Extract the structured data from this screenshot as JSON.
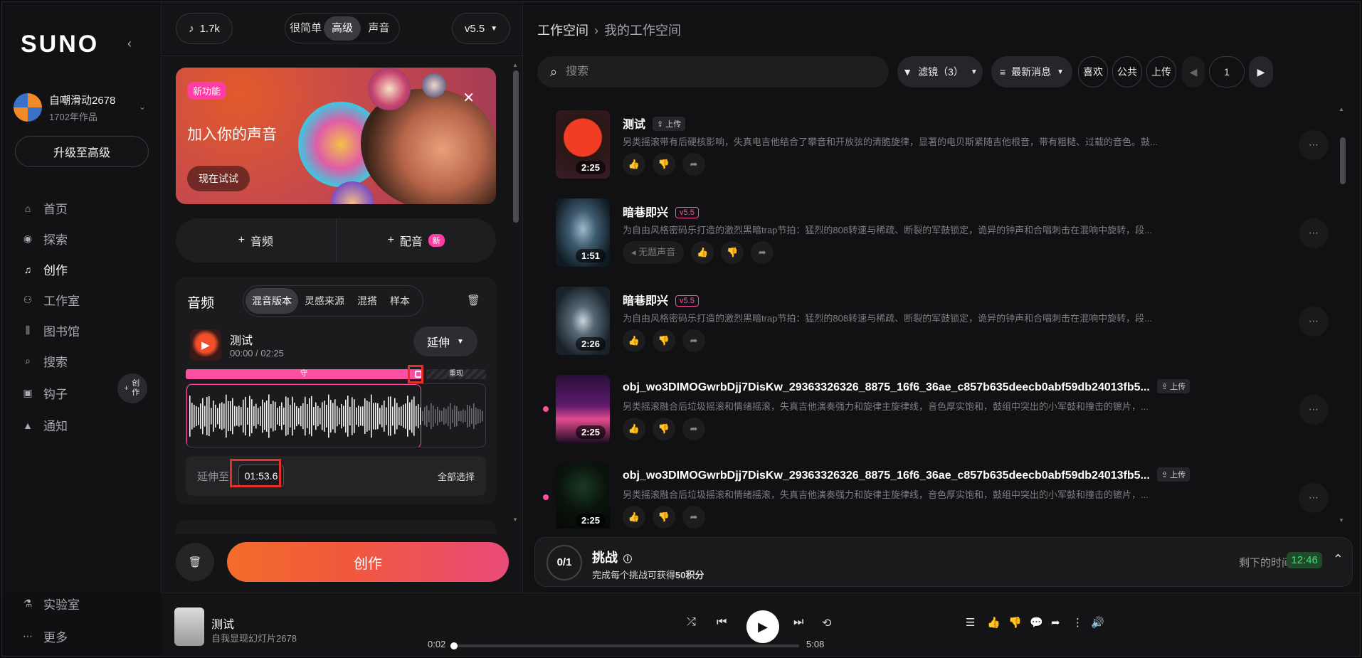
{
  "sidebar": {
    "logo": "SUNO",
    "user": {
      "name": "自嘲滑动2678",
      "works": "1702年作品"
    },
    "upgrade_label": "升级至高级",
    "items": [
      {
        "label": "首页",
        "icon": "home-icon"
      },
      {
        "label": "探索",
        "icon": "compass-icon"
      },
      {
        "label": "创作",
        "icon": "music-note-icon",
        "active": true
      },
      {
        "label": "工作室",
        "icon": "studio-icon"
      },
      {
        "label": "图书馆",
        "icon": "library-icon"
      },
      {
        "label": "搜索",
        "icon": "search-icon"
      },
      {
        "label": "钩子",
        "icon": "hook-icon"
      },
      {
        "label": "通知",
        "icon": "bell-icon"
      }
    ],
    "create_fab": "创作",
    "bottom_items": [
      {
        "label": "实验室",
        "icon": "flask-icon"
      },
      {
        "label": "更多",
        "icon": "more-dots-icon"
      }
    ]
  },
  "create": {
    "credits": "1.7k",
    "mode_tabs": [
      "很简单",
      "高级",
      "声音"
    ],
    "active_mode": "高级",
    "version": "v5.5",
    "promo": {
      "tag": "新功能",
      "title": "加入你的声音",
      "cta": "现在试试"
    },
    "add_audio": "音频",
    "add_voice": "配音",
    "add_voice_badge": "新",
    "audio_card": {
      "title": "音频",
      "tabs": [
        "混音版本",
        "灵感来源",
        "混搭",
        "样本"
      ],
      "active_tab": "混音版本",
      "clip_title": "测试",
      "clip_time": "00:00 / 02:25",
      "extend_label": "延伸",
      "keep_label": "守",
      "drop_label": "重现",
      "extend_to_label": "延伸至",
      "extend_to_time": "01:53.6",
      "select_all": "全部选择",
      "selection_fraction": 0.782
    },
    "create_button": "创作"
  },
  "workspace": {
    "breadcrumb_root": "工作空间",
    "breadcrumb_current": "我的工作空间",
    "search_placeholder": "搜索",
    "filter_label": "滤镜（3）",
    "sort_label": "最新消息",
    "liked_label": "喜欢",
    "public_label": "公共",
    "upload_label": "上传",
    "page_number": "1",
    "songs": [
      {
        "title": "测试",
        "tag": "上传",
        "tag_type": "upload",
        "desc": "另类摇滚带有后硬核影响，失真电吉他结合了攀音和开放弦的清脆旋律，显著的电贝斯紧随吉他根音，带有粗糙、过载的音色。鼓...",
        "duration": "2:25",
        "cover": "red"
      },
      {
        "title": "暗巷即兴",
        "tag": "v5.5",
        "tag_type": "version",
        "desc": "为自由风格密码乐打造的激烈黑暗trap节拍：猛烈的808转速与稀疏、断裂的军鼓锁定，诡异的钟声和合唱刺击在混响中旋转，段...",
        "duration": "1:51",
        "cover": "tunnel",
        "no_sound": "无题声音"
      },
      {
        "title": "暗巷即兴",
        "tag": "v5.5",
        "tag_type": "version",
        "desc": "为自由风格密码乐打造的激烈黑暗trap节拍：猛烈的808转速与稀疏、断裂的军鼓锁定，诡异的钟声和合唱刺击在混响中旋转，段...",
        "duration": "2:26",
        "cover": "tunnel2"
      },
      {
        "title": "obj_wo3DIMOGwrbDjj7DisKw_29363326326_8875_16f6_36ae_c857b635deecb0abf59db24013fb5...",
        "tag": "上传",
        "tag_type": "upload",
        "desc": "另类摇滚融合后垃圾摇滚和情绪摇滚，失真吉他演奏强力和旋律主旋律线，音色厚实饱和，鼓组中突出的小军鼓和撞击的镲片，...",
        "duration": "2:25",
        "cover": "synth",
        "dot": true
      },
      {
        "title": "obj_wo3DIMOGwrbDjj7DisKw_29363326326_8875_16f6_36ae_c857b635deecb0abf59db24013fb5...",
        "tag": "上传",
        "tag_type": "upload",
        "desc": "另类摇滚融合后垃圾摇滚和情绪摇滚，失真吉他演奏强力和旋律主旋律线，音色厚实饱和，鼓组中突出的小军鼓和撞击的镲片，...",
        "duration": "2:25",
        "cover": "dark",
        "dot": true
      }
    ],
    "challenge": {
      "progress": "0/1",
      "title": "挑战",
      "desc_prefix": "完成每个挑战可获得",
      "desc_points": "50积分",
      "remaining_label": "剩下的时间",
      "remaining_time": "12:46"
    }
  },
  "player": {
    "title": "测试",
    "artist": "自我显现幻灯片2678",
    "elapsed": "0:02",
    "total": "5:08",
    "progress_fraction": 0.0065
  }
}
